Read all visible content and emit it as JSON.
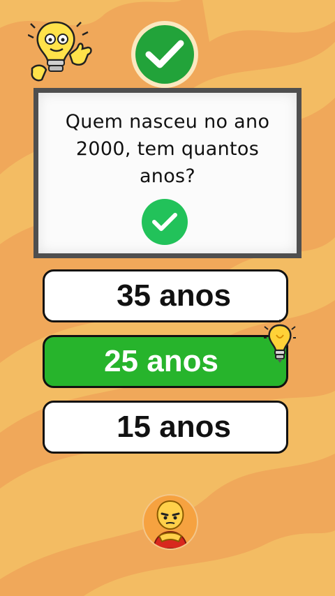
{
  "quiz": {
    "question": "Quem nasceu no ano 2000, tem quantos anos?",
    "question_lines": [
      "Quem nasceu no ano",
      "2000, tem quantos",
      "anos?"
    ],
    "answers": [
      {
        "label": "35 anos",
        "state": "default"
      },
      {
        "label": "25 anos",
        "state": "correct"
      },
      {
        "label": "15 anos",
        "state": "default"
      }
    ]
  },
  "colors": {
    "background": "#f0a85a",
    "wave_light": "#f3bc63",
    "card_frame": "#4f4f4f",
    "correct_green": "#27b42c",
    "check_green": "#22c25a"
  },
  "icons": {
    "top_badge": "check-circle-icon",
    "card_badge": "check-circle-icon",
    "mascot_top": "lightbulb-mascot",
    "answer_hint": "lightbulb-icon",
    "avatar": "hero-mascot-avatar"
  }
}
